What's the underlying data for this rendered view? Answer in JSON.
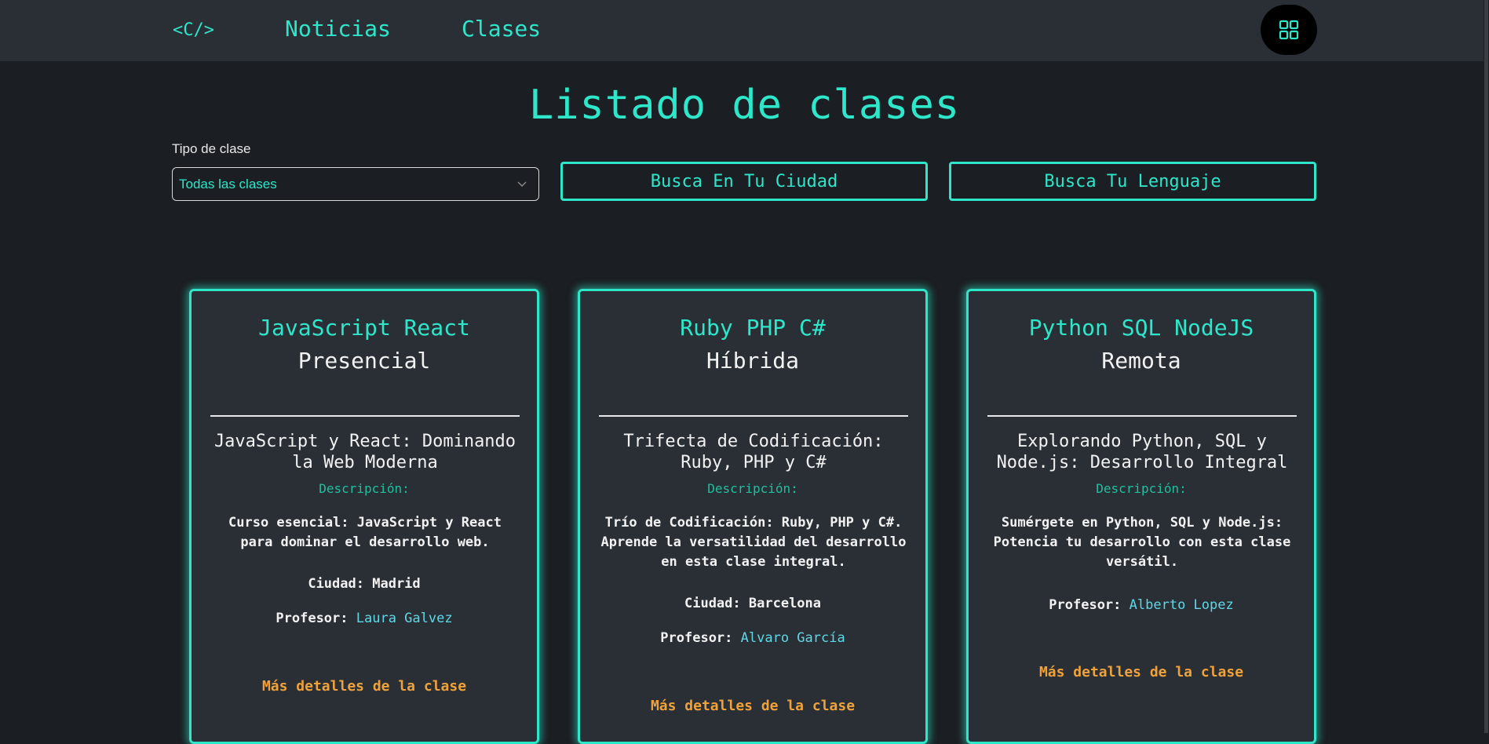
{
  "nav": {
    "logo": "<C/>",
    "links": [
      "Noticias",
      "Clases"
    ],
    "menu_icon": "grid-icon"
  },
  "page": {
    "title": "Listado de clases"
  },
  "filters": {
    "label": "Tipo de clase",
    "select_value": "Todas las clases",
    "btn_city": "Busca En Tu Ciudad",
    "btn_language": "Busca Tu Lenguaje"
  },
  "colors": {
    "accent": "#2ee6c9",
    "background": "#1b1e22",
    "card": "#2a2f36",
    "link_orange": "#f0a23a",
    "teacher_cyan": "#5fd8e6"
  },
  "cards": [
    {
      "langs": "JavaScript React",
      "modality": "Presencial",
      "title": "JavaScript y React: Dominando la Web Moderna",
      "desc_label": "Descripción:",
      "desc": "Curso esencial: JavaScript y React para dominar el desarrollo web.",
      "city_label": "Ciudad:",
      "city": "Madrid",
      "teacher_label": "Profesor:",
      "teacher": "Laura Galvez",
      "more": "Más detalles de la clase"
    },
    {
      "langs": "Ruby PHP C#",
      "modality": "Híbrida",
      "title": "Trifecta de Codificación: Ruby, PHP y C#",
      "desc_label": "Descripción:",
      "desc": "Trío de Codificación: Ruby, PHP y C#. Aprende la versatilidad del desarrollo en esta clase integral.",
      "city_label": "Ciudad:",
      "city": "Barcelona",
      "teacher_label": "Profesor:",
      "teacher": "Alvaro García",
      "more": "Más detalles de la clase"
    },
    {
      "langs": "Python SQL NodeJS",
      "modality": "Remota",
      "title": "Explorando Python, SQL y Node.js: Desarrollo Integral",
      "desc_label": "Descripción:",
      "desc": "Sumérgete en Python, SQL y Node.js: Potencia tu desarrollo con esta clase versátil.",
      "teacher_label": "Profesor:",
      "teacher": "Alberto Lopez",
      "more": "Más detalles de la clase"
    }
  ]
}
